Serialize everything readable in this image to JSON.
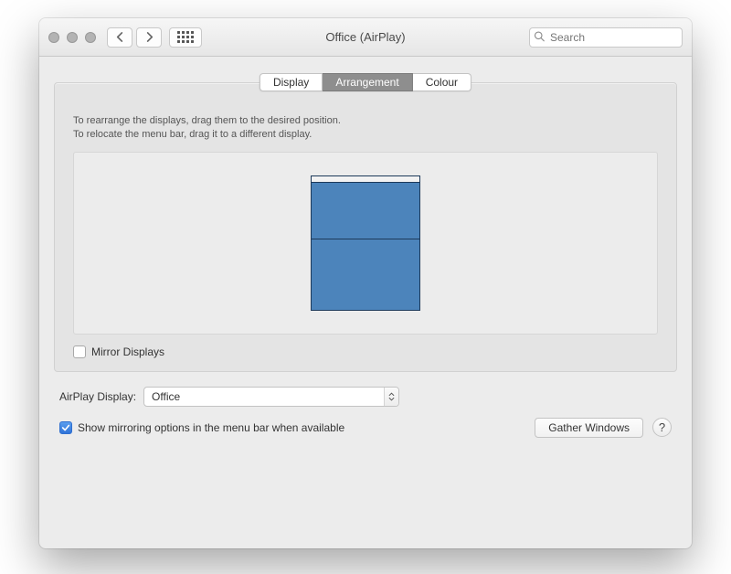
{
  "window": {
    "title": "Office (AirPlay)"
  },
  "search": {
    "placeholder": "Search",
    "value": ""
  },
  "tabs": {
    "display": "Display",
    "arrangement": "Arrangement",
    "colour": "Colour"
  },
  "help_text": {
    "line1": "To rearrange the displays, drag them to the desired position.",
    "line2": "To relocate the menu bar, drag it to a different display."
  },
  "mirror": {
    "label": "Mirror Displays",
    "checked": false
  },
  "airplay": {
    "label": "AirPlay Display:",
    "selected": "Office"
  },
  "show_mirroring": {
    "label": "Show mirroring options in the menu bar when available",
    "checked": true
  },
  "gather_windows": "Gather Windows",
  "help_button": "?"
}
